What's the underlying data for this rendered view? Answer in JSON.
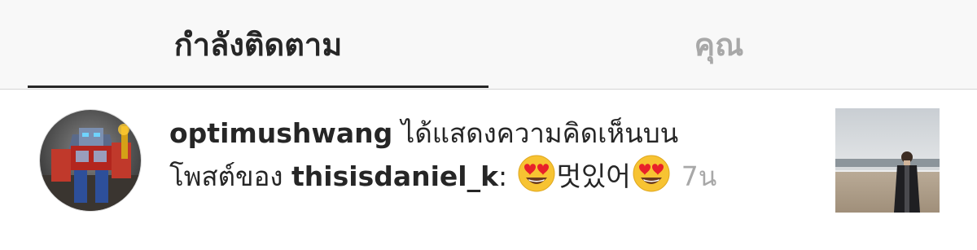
{
  "tabs": {
    "following": "กำลังติดตาม",
    "you": "คุณ",
    "active": "following"
  },
  "notification": {
    "actor": "optimushwang",
    "action_line1": " ได้แสดงความคิดเห็นบน",
    "action_line2": "โพสต์ของ ",
    "target_user": "thisisdaniel_k",
    "colon": ":",
    "comment_text": "멋있어",
    "comment_emoji": "heart-eyes-emoji",
    "time": "7น"
  },
  "colors": {
    "primary_text": "#262626",
    "secondary_text": "#a8a8a8",
    "tab_bar_bg": "#f8f8f8"
  }
}
